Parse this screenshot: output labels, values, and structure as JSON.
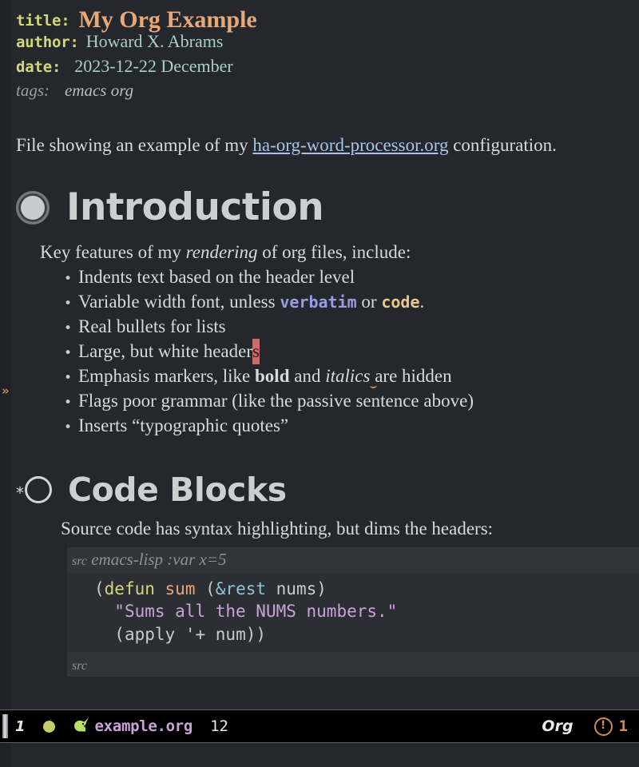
{
  "header": {
    "title_key": "title:",
    "title_value": "My Org Example",
    "author_key": "author:",
    "author_value": "Howard X. Abrams",
    "date_key": "date:",
    "date_value": "2023-12-22 December",
    "tags_key": "tags:",
    "tags_value": "emacs org"
  },
  "intro": {
    "before_link": "File showing an example of my ",
    "link_text": "ha-org-word-processor.org",
    "after_link": " configuration."
  },
  "sections": [
    {
      "heading": "Introduction",
      "level": 1,
      "lead": {
        "part1": "Key features of my ",
        "emphasis": "rendering",
        "part2": " of org files, include:"
      },
      "bullets": [
        {
          "text": "Indents text based on the header level"
        },
        {
          "pre": "Variable width font, unless ",
          "verbatim": "verbatim",
          "mid": " or ",
          "code": "code",
          "post": "."
        },
        {
          "text": "Real bullets for lists"
        },
        {
          "pre": "Large, but white header",
          "cursor": "s",
          "post": ""
        },
        {
          "pre": "Emphasis markers, like ",
          "bold": "bold",
          "mid": " and ",
          "italic": "italics",
          "post": " are hidden"
        },
        {
          "text": "Flags poor grammar (like the passive sentence above)"
        },
        {
          "text": "Inserts “typographic quotes”"
        }
      ]
    },
    {
      "heading": "Code Blocks",
      "level": 2,
      "star": "*",
      "lead_text": "Source code has syntax highlighting, but dims the headers:",
      "src_block": {
        "begin_word": "src",
        "begin_args": "emacs-lisp :var x=5",
        "end_word": "src",
        "lines": [
          [
            {
              "t": "(",
              "c": "paren"
            },
            {
              "t": "defun",
              "c": "kw"
            },
            {
              "t": " ",
              "c": "sym"
            },
            {
              "t": "sum",
              "c": "fn"
            },
            {
              "t": " ",
              "c": "sym"
            },
            {
              "t": "(",
              "c": "paren"
            },
            {
              "t": "&rest",
              "c": "amp"
            },
            {
              "t": " ",
              "c": "sym"
            },
            {
              "t": "nums",
              "c": "sym"
            },
            {
              "t": ")",
              "c": "paren"
            }
          ],
          [
            {
              "t": "  ",
              "c": "sym"
            },
            {
              "t": "\"Sums all the NUMS numbers.\"",
              "c": "str"
            }
          ],
          [
            {
              "t": "  ",
              "c": "sym"
            },
            {
              "t": "(",
              "c": "paren"
            },
            {
              "t": "apply",
              "c": "sym"
            },
            {
              "t": " ",
              "c": "sym"
            },
            {
              "t": "'+",
              "c": "sym"
            },
            {
              "t": " ",
              "c": "sym"
            },
            {
              "t": "num",
              "c": "sym"
            },
            {
              "t": "))",
              "c": "paren"
            }
          ]
        ]
      }
    }
  ],
  "fringe": {
    "continuation_marker": "»"
  },
  "mode_line": {
    "window_number": "1",
    "buffer_icon": "🦄",
    "buffer_name": "example.org",
    "position": "12",
    "major_mode": "Org",
    "error_icon": "!",
    "error_count": "1"
  },
  "colors": {
    "background": "#24272c",
    "fringe": "#1e2125",
    "keyword": "#d5d67a",
    "value": "#a9cfc8",
    "title": "#e8a878",
    "link": "#a8c5e8",
    "heading": "#ccced0",
    "body": "#d7dadd",
    "verbatim": "#9a9ce0",
    "code": "#e8c88a",
    "cursor": "#cc6b6b",
    "string": "#c9a3d8",
    "function": "#e8a878",
    "modeline_bg": "#000000",
    "buffer_name": "#c9a3d8",
    "error": "#d08a52"
  }
}
